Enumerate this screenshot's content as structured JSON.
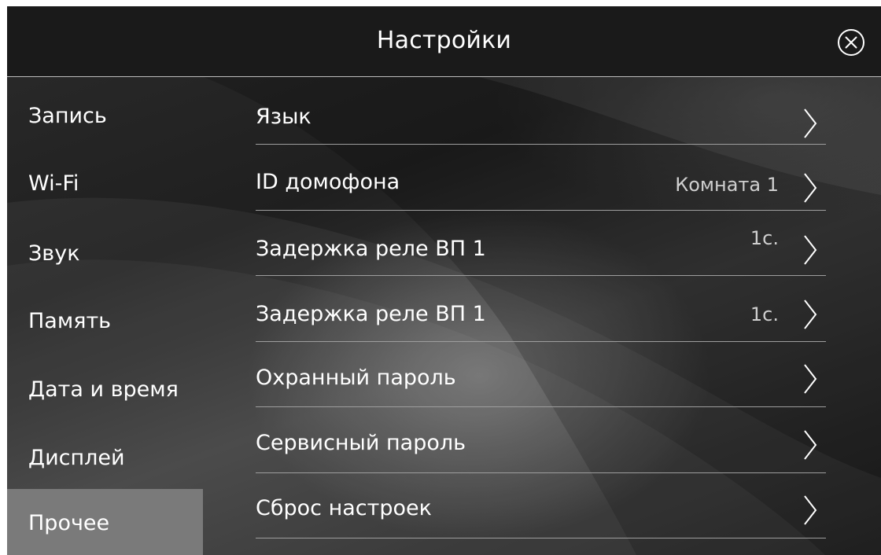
{
  "header": {
    "title": "Настройки",
    "close_icon": "close-circle-icon"
  },
  "sidebar": {
    "active_index": 6,
    "items": [
      {
        "label": "Запись"
      },
      {
        "label": "Wi-Fi"
      },
      {
        "label": "Звук"
      },
      {
        "label": "Память"
      },
      {
        "label": "Дата и время"
      },
      {
        "label": "Дисплей"
      },
      {
        "label": "Прочее"
      }
    ]
  },
  "settings": {
    "rows": [
      {
        "label": "Язык",
        "value": ""
      },
      {
        "label": "ID домофона",
        "value": "Комната 1"
      },
      {
        "label": "Задержка реле ВП 1",
        "value": "1с."
      },
      {
        "label": "Задержка реле ВП 1",
        "value": "1с."
      },
      {
        "label": "Охранный пароль",
        "value": ""
      },
      {
        "label": "Сервисный пароль",
        "value": ""
      },
      {
        "label": "Сброс настроек",
        "value": ""
      }
    ],
    "chevron_icon": "chevron-right-icon"
  },
  "colors": {
    "header_bg": "#1a1a1a",
    "active_item_bg": "#7a7a7a",
    "divider": "#9e9e9e",
    "text": "#ffffff",
    "value_text": "#cfcfcf"
  }
}
